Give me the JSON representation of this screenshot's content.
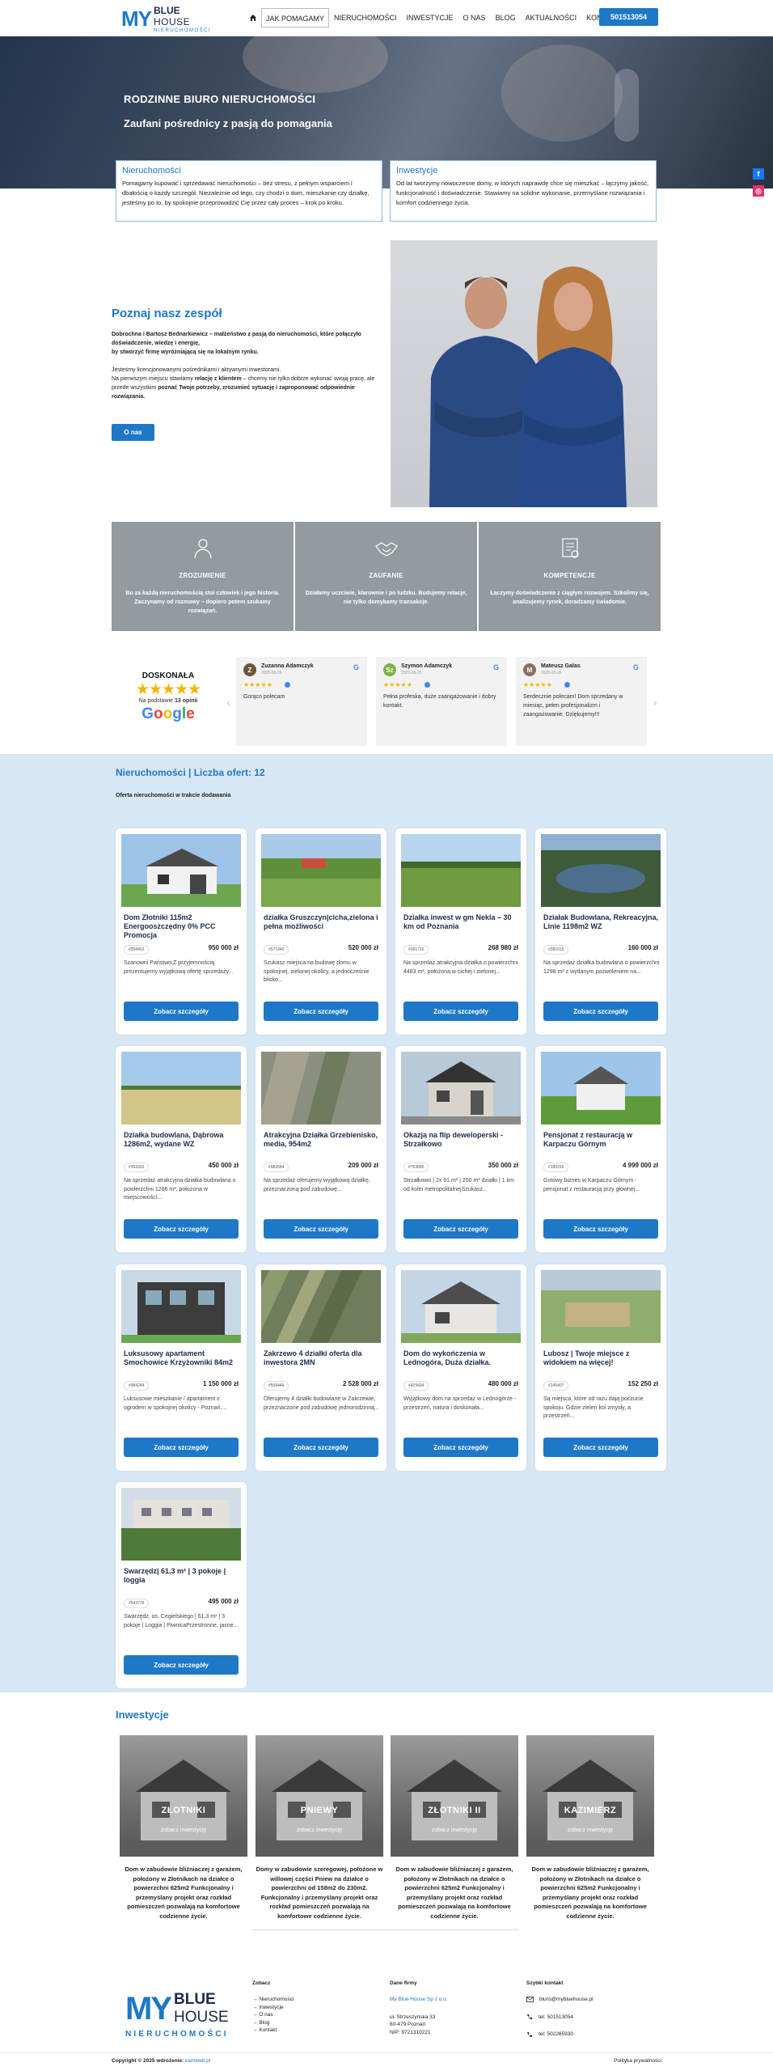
{
  "header": {
    "logo": {
      "my": "MY",
      "line1": "BLUE",
      "line2": "HOUSE",
      "line3": "NIERUCHOMOŚCI"
    },
    "nav": [
      "JAK POMAGAMY",
      "NIERUCHOMOŚCI",
      "INWESTYCJE",
      "O NAS",
      "BLOG",
      "AKTUALNOŚCI",
      "KONTAKT"
    ],
    "active_nav": "JAK POMAGAMY",
    "phone": "501513054"
  },
  "hero": {
    "title": "RODZINNE BIURO NIERUCHOMOŚCI",
    "subtitle": "Zaufani pośrednicy z pasją do pomagania"
  },
  "intro": [
    {
      "title": "Nieruchomości",
      "text": "Pomagamy kupować i sprzedawać nieruchomości – bez stresu, z pełnym wsparciem i dbałością o każdy szczegół. Niezależnie od tego, czy chodzi o dom, mieszkanie czy działkę, jesteśmy po to, by spokojnie przeprowadzić Cię przez cały proces – krok po kroku."
    },
    {
      "title": "Inwestycje",
      "text": "Od lat tworzymy nowoczesne domy, w których naprawdę chce się mieszkać – łączymy jakość, funkcjonalność i doświadczenie. Stawiamy na solidne wykonanie, przemyślane rozwiązania i komfort codziennego życia."
    }
  ],
  "social": {
    "facebook": "f",
    "instagram": "◎"
  },
  "team": {
    "title": "Poznaj nasz zespół",
    "p1_bold": "Dobrochna i Bartosz Bednarkiewicz – małżeństwo z pasją do nieruchomości, które połączyło doświadczenie, wiedzę i energię,",
    "p1_rest": "by stworzyć firmę wyróżniającą się na lokalnym rynku.",
    "p2": "Jesteśmy licencjonowanymi pośrednikami i aktywnymi inwestorami.",
    "p3_a": "Na pierwszym miejscu stawiamy ",
    "p3_b": "relację z klientem",
    "p3_c": " – chcemy nie tylko dobrze wykonać swoją pracę, ale przede wszystkim ",
    "p3_d": "poznać Twoje potrzeby, zrozumieć sytuację i zaproponować odpowiednie rozwiązania.",
    "button": "O nas"
  },
  "features": [
    {
      "title": "ZROZUMIENIE",
      "text": "Bo za każdą nieruchomością stoi człowiek i jego historia. Zaczynamy od rozmowy – dopiero potem szukamy rozwiązań.",
      "icon": "person-icon"
    },
    {
      "title": "ZAUFANIE",
      "text": "Działamy uczciwie, klarownie i po ludzku. Budujemy relacje, nie tylko domykamy transakcje.",
      "icon": "handshake-icon"
    },
    {
      "title": "KOMPETENCJE",
      "text": "Łączymy doświadczenie z ciągłym rozwojem. Szkolimy się, analizujemy rynek, doradzamy świadomie.",
      "icon": "certificate-icon"
    }
  ],
  "rating": {
    "label": "DOSKONAŁA",
    "stars": "★★★★★",
    "basis_a": "Na podstawie ",
    "basis_b": "13 opinii",
    "provider": "Google"
  },
  "reviews": [
    {
      "initial": "Z",
      "name": "Zuzanna Adamczyk",
      "date": "2025-06-26",
      "text": "Gorąco polecam",
      "color": "#6d5538"
    },
    {
      "initial": "Sz",
      "name": "Szymon Adamczyk",
      "date": "2025-06-25",
      "text": "Pełna profeska, duże zaangażowanie i dobry kontakt.",
      "color": "#7cb342"
    },
    {
      "initial": "M",
      "name": "Mateusz Galas",
      "date": "2025-05-26",
      "text": "Serdecznie polecam! Dom sprzedany w miesiąc, pełen profesjonalizm i zaangażowanie. Dziękujemy!!!",
      "color": "#8d6e63"
    }
  ],
  "offers": {
    "title": "Nieruchomości | Liczba ofert: 12",
    "subtitle": "Oferta nieruchomości w trakcie dodawania",
    "button": "Zobacz szczegóły",
    "items": [
      {
        "title": "Dom Złotniki 115m2 Energooszczędny 0% PCC Promocja",
        "id": "#358402",
        "price": "950 000 zł",
        "desc": "Szanowni Państwo,Z przyjemnością prezentujemy wyjątkową ofertę sprzedaży...",
        "img": "house-white"
      },
      {
        "title": "działka Gruszczyn|cicha,zielona i pełna możliwości",
        "id": "#571940",
        "price": "520 000 zł",
        "desc": "Szukasz miejsca na budowę domu w spokojnej, zielonej okolicy, a jednocześnie blisko...",
        "img": "field-green"
      },
      {
        "title": "Działka inwest w gm Nekla – 30 km od Poznania",
        "id": "#391720",
        "price": "268 980 zł",
        "desc": "Na sprzedaż atrakcyjna działka o powierzchni 4483 m², położona w cichej i zielonej...",
        "img": "meadow"
      },
      {
        "title": "Działak Budowlana, Rekreacyjna, Linie 1198m2 WZ",
        "id": "#281016",
        "price": "160 000 zł",
        "desc": "Na sprzedaż działka budowlana o powierzchni 1298 m² z wydanym pozwoleniem na...",
        "img": "lake"
      },
      {
        "title": "Działka budowlana, Dąbrowa 1286m2, wydane WZ",
        "id": "#353302",
        "price": "450 000 zł",
        "desc": "Na sprzedaż atrakcyjna działka budowlana o powierzchni 1286 m², położona w miejscowości...",
        "img": "plain"
      },
      {
        "title": "Atrakcyjna Działka Grzebienisko, media, 954m2",
        "id": "#982684",
        "price": "209 000 zł",
        "desc": "Na sprzedaż oferujemy wyjątkową działkę, przeznaczoną pod zabudowę...",
        "img": "aerial"
      },
      {
        "title": "Okazja na flip deweloperski - Strzałkowo",
        "id": "#753680",
        "price": "350 000 zł",
        "desc": "Strzałkowo | 2x 91 m² | 250 m² działki | 1 km od kolei metropolitalnejSzukasz...",
        "img": "house-dark"
      },
      {
        "title": "Pensjonat z restauracją w Karpaczu Górnym",
        "id": "#180316",
        "price": "4 999 000 zł",
        "desc": "Gotowy biznes w Karpaczu Górnym - pensjonat z restauracją przy głównej...",
        "img": "hotel"
      },
      {
        "title": "Luksusowy apartament Smochowice Krzyżowniki 84m2",
        "id": "#984244",
        "price": "1 150 000 zł",
        "desc": "Luksusowe mieszkanie / apartament z ogrodem w spokojnej okolicy - Poznań,...",
        "img": "modern"
      },
      {
        "title": "Zakrzewo 4 działki oferta dla inwestora 2MN",
        "id": "#509446",
        "price": "2 528 000 zł",
        "desc": "Oferujemy 4 działki budowlane w Zakrzewie, przeznaczone pod zabudowę jednorodzinną...",
        "img": "aerial2"
      },
      {
        "title": "Dom do wykończenia w Lednogóra, Duża działka.",
        "id": "#429434",
        "price": "480 000 zł",
        "desc": "Wyjątkowy dom na sprzedaż w Lednogórze - przestrzeń, natura i doskonała...",
        "img": "house-grey"
      },
      {
        "title": "Lubosz | Twoje miejsce z widokiem na więcej!",
        "id": "#145407",
        "price": "152 250 zł",
        "desc": "Są miejsca, które od razu dają poczucie spokoju. Gdzie zieleń koi zmysły, a przestrzeń...",
        "img": "aerial3"
      },
      {
        "title": "Swarzędz| 61,3 m² | 3 pokoje | loggia",
        "id": "#543776",
        "price": "495 000 zł",
        "desc": "Swarzędz, os. Cegielskiego | 61,3 m² | 3 pokoje | Loggia | PiwnicaPrzestronne, jasne...",
        "img": "block"
      }
    ]
  },
  "investments": {
    "title": "Inwestycje",
    "sub": "zobacz inwestycję",
    "items": [
      {
        "name": "ZŁOTNIKI",
        "text": "Dom w zabudowie bliźniaczej z garażem, położony w Złotnikach na działce o powierzchni 625m2 Funkcjonalny i przemyślany projekt oraz rozkład pomieszczeń pozwalają na komfortowe codzienne życie."
      },
      {
        "name": "PNIEWY",
        "text": "Domy w zabudowie szeregowej, położone w willowej części Pniew na działce o powierzchni od 158m2 do 230m2. Funkcjonalny i przemyślany projekt oraz rozkład pomieszczeń pozwalają na komfortowe codzienne życie."
      },
      {
        "name": "ZŁOTNIKI II",
        "text": "Dom w zabudowie bliźniaczej z garażem, położony w Złotnikach na działce o powierzchni 625m2 Funkcjonalny i przemyślany projekt oraz rozkład pomieszczeń pozwalają na komfortowe codzienne życie."
      },
      {
        "name": "KAZIMIERZ",
        "text": "Dom w zabudowie bliźniaczej z garażem, położony w Złotnikach na działce o powierzchni 625m2 Funkcjonalny i przemyślany projekt oraz rozkład pomieszczeń pozwalają na komfortowe codzienne życie."
      }
    ]
  },
  "footer": {
    "col1_title": "Zobacz",
    "links": [
      "Nieruchomości",
      "Inwestycje",
      "O nas",
      "Blog",
      "Kontakt"
    ],
    "col2_title": "Dane firmy",
    "company": "My Blue House Sp z o.o.",
    "street": "ul. Strzeszyńska 33",
    "city": "60-479 Poznań",
    "nip": "NIP: 9721310221",
    "col3_title": "Szybki kontakt",
    "email": "biuro@mybluehouse.pl",
    "tel1": "tel: 501513054",
    "tel2": "tel: 502265930",
    "copyright": "Copyright © 2025 wdrożenie: ",
    "agency": "kamweb.pl",
    "privacy": "Polityka prywatności"
  }
}
